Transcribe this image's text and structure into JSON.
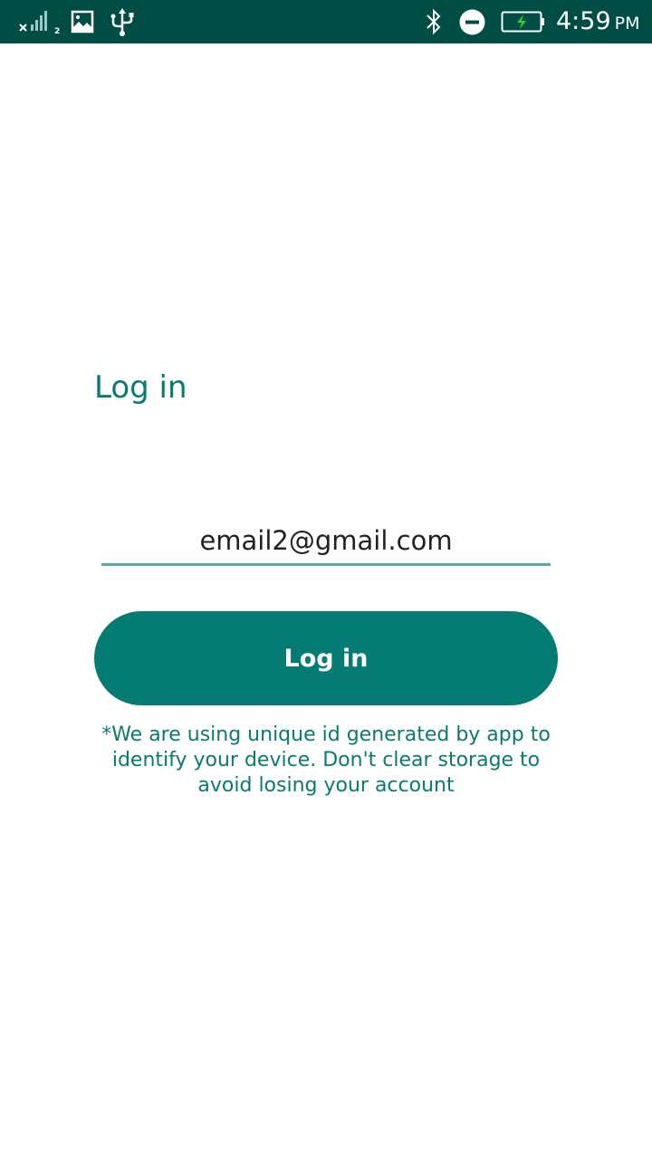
{
  "status_bar": {
    "time": "4:59",
    "ampm": "PM",
    "sim_slot": "2",
    "icons": [
      "signal-icon",
      "image-icon",
      "usb-icon",
      "bluetooth-icon",
      "do-not-disturb-icon",
      "battery-charging-icon"
    ],
    "background_color": "#004d45",
    "battery_bolt_color": "#33cc33"
  },
  "page": {
    "title": "Log in"
  },
  "login_form": {
    "email_value": "email2@gmail.com",
    "submit_label": "Log in",
    "notice": "*We are using unique id generated by app to identify your device. Don't clear storage to avoid losing your account"
  },
  "colors": {
    "accent": "#047c74",
    "accent_text": "#0a7a71",
    "input_underline": "#5aa9a6"
  }
}
